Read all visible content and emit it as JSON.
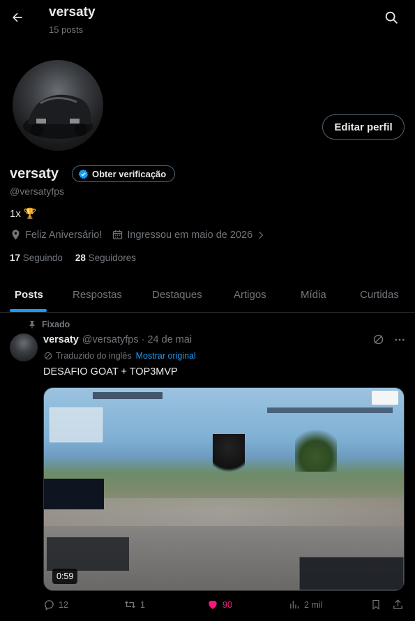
{
  "header": {
    "title": "versaty",
    "subtitle": "15 posts"
  },
  "profile": {
    "display_name": "versaty",
    "handle": "@versatyfps",
    "verify_label": "Obter verificação",
    "edit_label": "Editar perfil",
    "bio_text": "1x",
    "bio_emoji": "🏆",
    "birthday": "Feliz Aniversário!",
    "joined": "Ingressou em maio de 2026",
    "following_count": "17",
    "following_label": "Seguindo",
    "followers_count": "28",
    "followers_label": "Seguidores"
  },
  "tabs": [
    {
      "label": "Posts",
      "active": true
    },
    {
      "label": "Respostas"
    },
    {
      "label": "Destaques"
    },
    {
      "label": "Artigos"
    },
    {
      "label": "Mídia"
    },
    {
      "label": "Curtidas"
    }
  ],
  "post": {
    "pinned_label": "Fixado",
    "name": "versaty",
    "handle_date": "@versatyfps · 24 de mai",
    "translated_label": "Traduzido do inglês",
    "show_original": "Mostrar original",
    "text": "DESAFIO GOAT + TOP3MVP",
    "video_duration": "0:59",
    "stats": {
      "replies": "12",
      "reposts": "1",
      "likes": "90",
      "views": "2 mil"
    }
  },
  "colors": {
    "accent": "#1d9bf0",
    "like": "#f91880",
    "muted": "#71767b",
    "background": "#000000"
  },
  "icons": [
    "back-arrow-icon",
    "search-icon",
    "verified-badge-icon",
    "location-icon",
    "calendar-icon",
    "chevron-right-icon",
    "pin-icon",
    "grok-icon",
    "more-icon",
    "translate-icon",
    "reply-icon",
    "repost-icon",
    "heart-icon",
    "views-icon",
    "bookmark-icon",
    "share-icon"
  ]
}
